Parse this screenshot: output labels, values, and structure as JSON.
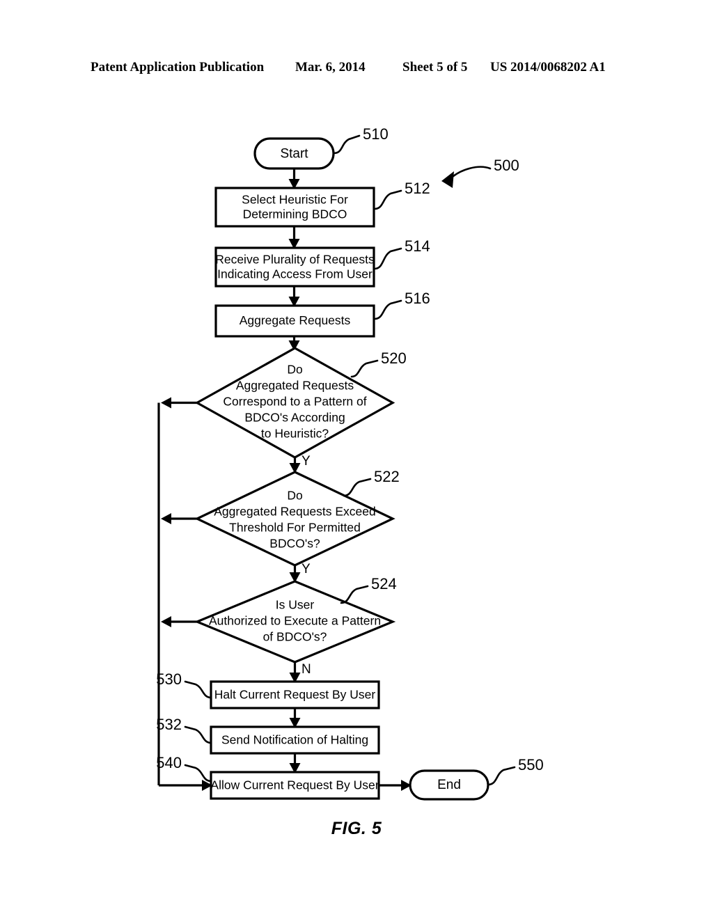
{
  "header": {
    "publication": "Patent Application Publication",
    "date": "Mar. 6, 2014",
    "sheet": "Sheet 5 of 5",
    "patent_number": "US 2014/0068202 A1"
  },
  "figure": {
    "caption": "FIG. 5",
    "diagram_ref": "500",
    "colors": {
      "stroke": "#000000",
      "fill": "#ffffff",
      "background": "#ffffff"
    },
    "nodes": [
      {
        "id": "510",
        "ref": "510",
        "type": "terminator",
        "lines": [
          "Start"
        ]
      },
      {
        "id": "512",
        "ref": "512",
        "type": "process",
        "lines": [
          "Select Heuristic For",
          "Determining BDCO"
        ]
      },
      {
        "id": "514",
        "ref": "514",
        "type": "process",
        "lines": [
          "Receive Plurality of Requests",
          "Indicating Access From User"
        ]
      },
      {
        "id": "516",
        "ref": "516",
        "type": "process",
        "lines": [
          "Aggregate Requests"
        ]
      },
      {
        "id": "520",
        "ref": "520",
        "type": "decision",
        "lines": [
          "Do",
          "Aggregated Requests",
          "Correspond to a Pattern of",
          "BDCO's According",
          "to Heuristic?"
        ],
        "exit_label": "Y"
      },
      {
        "id": "522",
        "ref": "522",
        "type": "decision",
        "lines": [
          "Do",
          "Aggregated Requests Exceed",
          "Threshold For Permitted",
          "BDCO's?"
        ],
        "exit_label": "Y"
      },
      {
        "id": "524",
        "ref": "524",
        "type": "decision",
        "lines": [
          "Is User",
          "Authorized to Execute a Pattern",
          "of BDCO's?"
        ],
        "exit_label": "N"
      },
      {
        "id": "530",
        "ref": "530",
        "type": "process",
        "lines": [
          "Halt Current Request By User"
        ]
      },
      {
        "id": "532",
        "ref": "532",
        "type": "process",
        "lines": [
          "Send Notification of Halting"
        ]
      },
      {
        "id": "540",
        "ref": "540",
        "type": "process",
        "lines": [
          "Allow Current Request By User"
        ]
      },
      {
        "id": "550",
        "ref": "550",
        "type": "terminator",
        "lines": [
          "End"
        ]
      }
    ]
  }
}
